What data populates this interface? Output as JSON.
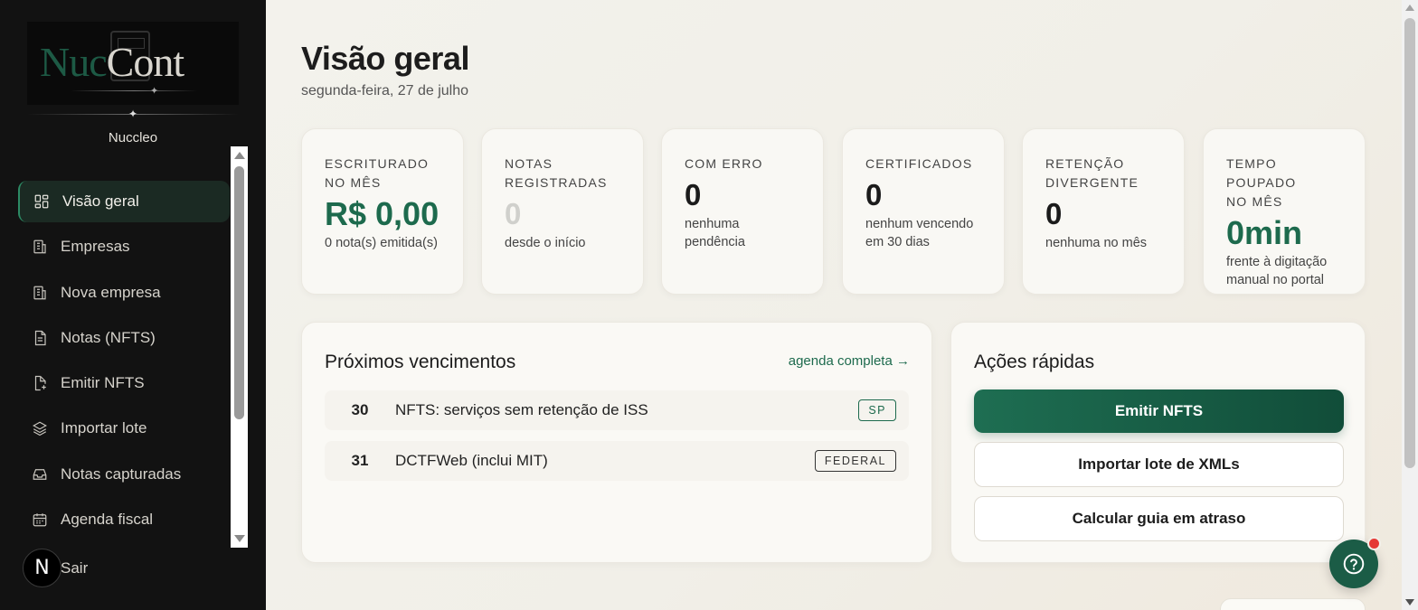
{
  "brand": {
    "logo_part1": "Nuc",
    "logo_part2": "Cont",
    "name": "Nuccleo"
  },
  "sidebar": {
    "items": [
      {
        "label": "Visão geral",
        "icon": "dashboard-icon",
        "active": true
      },
      {
        "label": "Empresas",
        "icon": "building-icon"
      },
      {
        "label": "Nova empresa",
        "icon": "building-plus-icon"
      },
      {
        "label": "Notas (NFTS)",
        "icon": "document-icon"
      },
      {
        "label": "Emitir NFTS",
        "icon": "file-plus-icon"
      },
      {
        "label": "Importar lote",
        "icon": "layers-icon"
      },
      {
        "label": "Notas capturadas",
        "icon": "inbox-icon"
      },
      {
        "label": "Agenda fiscal",
        "icon": "calendar-icon"
      }
    ],
    "avatar_letter": "N",
    "logout_label": "Sair"
  },
  "header": {
    "title": "Visão geral",
    "date": "segunda-feira, 27 de julho"
  },
  "stats": [
    {
      "label_line1": "ESCRITURADO",
      "label_line2": "NO MÊS",
      "value": "R$ 0,00",
      "sub_line1": "0 nota(s) emitida(s)",
      "sub_line2": ""
    },
    {
      "label_line1": "NOTAS",
      "label_line2": "REGISTRADAS",
      "value": "0",
      "sub_line1": "desde o início",
      "sub_line2": ""
    },
    {
      "label_line1": "COM ERRO",
      "label_line2": "",
      "value": "0",
      "sub_line1": "nenhuma",
      "sub_line2": "pendência"
    },
    {
      "label_line1": "CERTIFICADOS",
      "label_line2": "",
      "value": "0",
      "sub_line1": "nenhum vencendo",
      "sub_line2": "em 30 dias"
    },
    {
      "label_line1": "RETENÇÃO",
      "label_line2": "DIVERGENTE",
      "value": "0",
      "sub_line1": "nenhuma no mês",
      "sub_line2": ""
    },
    {
      "label_line1": "TEMPO POUPADO",
      "label_line2": "NO MÊS",
      "value": "0min",
      "sub_line1": "frente à digitação",
      "sub_line2": "manual no portal"
    }
  ],
  "vencimentos": {
    "title": "Próximos vencimentos",
    "link": "agenda completa →",
    "rows": [
      {
        "day": "30",
        "desc": "NFTS: serviços sem retenção de ISS",
        "tag": "SP"
      },
      {
        "day": "31",
        "desc": "DCTFWeb (inclui MIT)",
        "tag": "FEDERAL"
      }
    ]
  },
  "acoes": {
    "title": "Ações rápidas",
    "emitir": "Emitir NFTS",
    "importar": "Importar lote de XMLs",
    "calcular": "Calcular guia em atraso"
  },
  "colors": {
    "accent": "#1d6a4d",
    "sidebar_bg": "#121212",
    "notification": "#e53935"
  }
}
